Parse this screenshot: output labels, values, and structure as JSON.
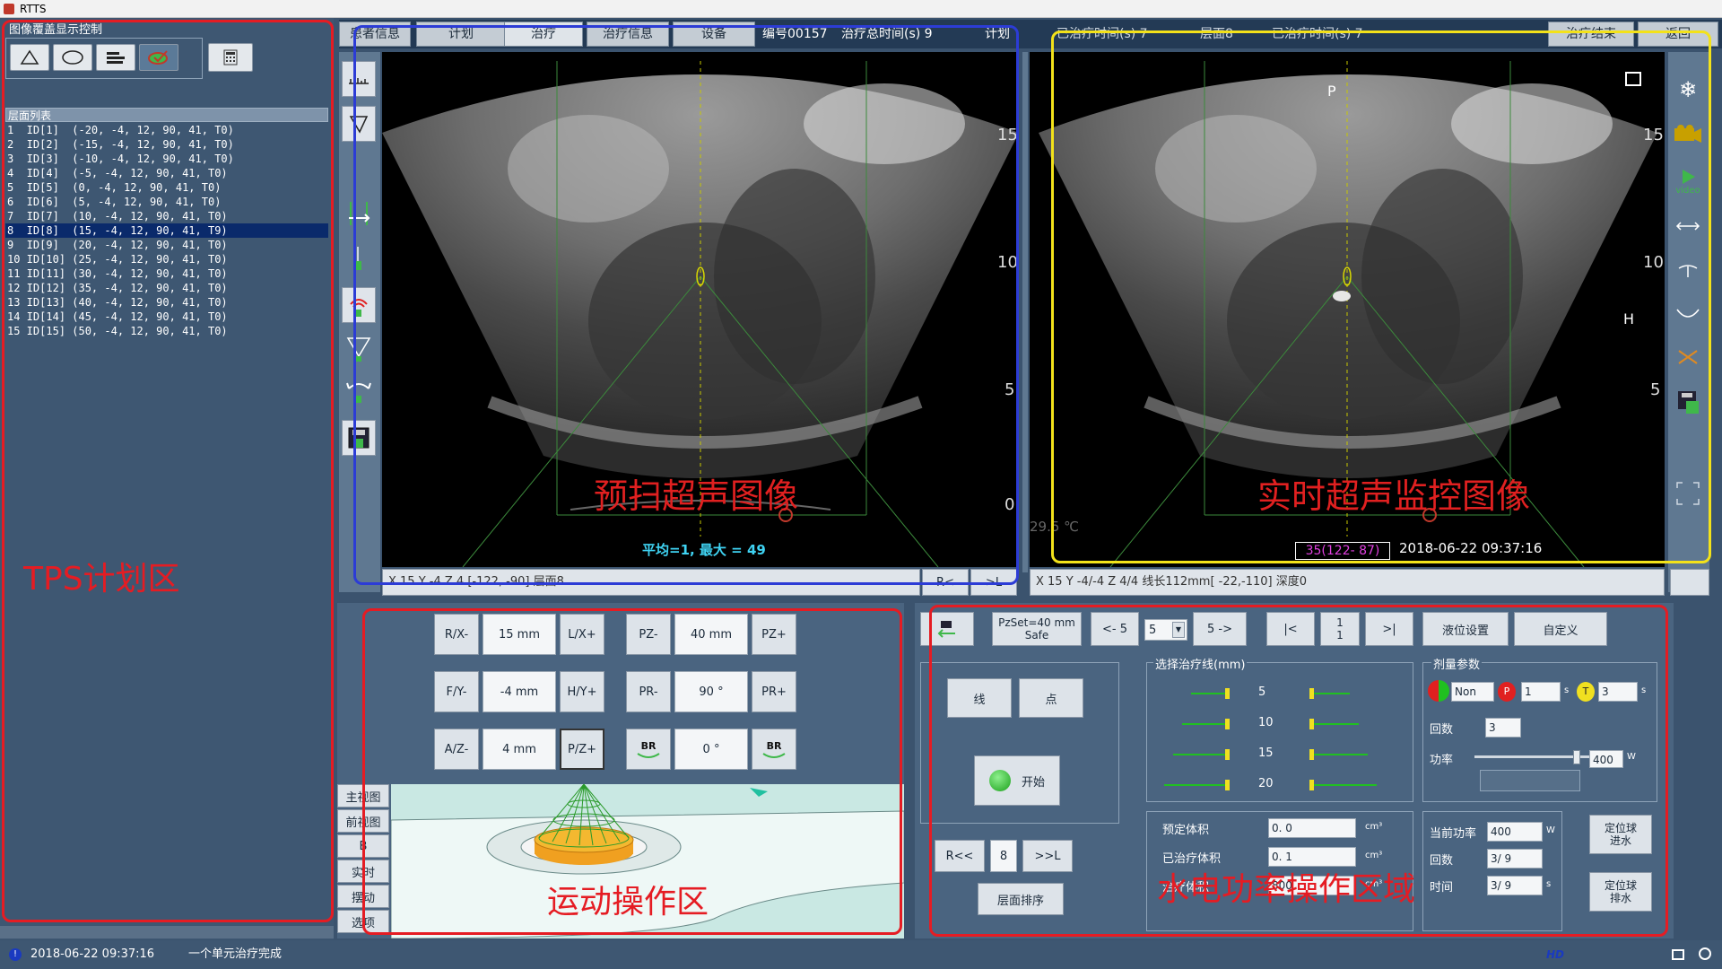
{
  "window": {
    "title": "RTTS"
  },
  "left_panel": {
    "overlay_group_title": "图像覆盖显示控制",
    "layer_list_header": "层面列表",
    "layers": [
      "1  ID[1]  (-20, -4, 12, 90, 41, T0)",
      "2  ID[2]  (-15, -4, 12, 90, 41, T0)",
      "3  ID[3]  (-10, -4, 12, 90, 41, T0)",
      "4  ID[4]  (-5, -4, 12, 90, 41, T0)",
      "5  ID[5]  (0, -4, 12, 90, 41, T0)",
      "6  ID[6]  (5, -4, 12, 90, 41, T0)",
      "7  ID[7]  (10, -4, 12, 90, 41, T0)",
      "8  ID[8]  (15, -4, 12, 90, 41, T9)",
      "9  ID[9]  (20, -4, 12, 90, 41, T0)",
      "10 ID[10] (25, -4, 12, 90, 41, T0)",
      "11 ID[11] (30, -4, 12, 90, 41, T0)",
      "12 ID[12] (35, -4, 12, 90, 41, T0)",
      "13 ID[13] (40, -4, 12, 90, 41, T0)",
      "14 ID[14] (45, -4, 12, 90, 41, T0)",
      "15 ID[15] (50, -4, 12, 90, 41, T0)"
    ],
    "selected_layer_index": 7,
    "region_label": "TPS计划区"
  },
  "tabs": {
    "patient_info": "患者信息",
    "plan": "计划",
    "treatment": "治疗",
    "treatment_info": "治疗信息",
    "device": "设备",
    "serial_text": "编号00157",
    "total_time_text": "治疗总时间(s) 9",
    "plan_text": "计划",
    "treated_time_text": "已治疗时间(s) 7",
    "layer_text": "层面8",
    "treated_time2_text": "已治疗时间(s) 7",
    "end_treatment": "治疗结束",
    "back": "返回"
  },
  "left_image": {
    "label": "预扫超声图像",
    "stats": "平均=1, 最大 = 49",
    "scale": [
      "15",
      "10",
      "5",
      "0"
    ],
    "status": "X 15   Y -4   Z 4      [-122, -90]  层面8",
    "nav_prev": "R<",
    "nav_next": ">L"
  },
  "right_image": {
    "label": "实时超声监控图像",
    "orientation_top": "P",
    "orientation_right": "H",
    "temperature": "29.5 ℃",
    "counter": "35(122- 87)",
    "timestamp": "2018-06-22 09:37:16",
    "scale": [
      "15",
      "10",
      "5",
      "0"
    ],
    "status": "X 15   Y -4/-4  Z    4/4  线长112mm[ -22,-110]  深度0",
    "video_label": "video"
  },
  "motion": {
    "region_label": "运动操作区",
    "rx_minus": "R/X-",
    "x_value": "15  mm",
    "lx_plus": "L/X+",
    "fy_minus": "F/Y-",
    "y_value": "-4  mm",
    "hy_plus": "H/Y+",
    "az_minus": "A/Z-",
    "z_value": "4  mm",
    "pz_plus_small": "P/Z+",
    "pz_minus": "PZ-",
    "pz_value": "40  mm",
    "pz_plus": "PZ+",
    "pr_minus": "PR-",
    "pr_value": "90  °",
    "pr_plus": "PR+",
    "br_value": "0  °",
    "br_label": "BR",
    "views": [
      "主视图",
      "前视图",
      "B",
      "实时",
      "摆动",
      "选项"
    ]
  },
  "water_power": {
    "region_label": "水电功率操作区域",
    "pzset": "PzSet=40 mm",
    "safe": "Safe",
    "prev5": "<- 5",
    "step_select": "5",
    "next5": "5 ->",
    "first": "|<",
    "page_top": "1",
    "page_bottom": "1",
    "last": ">|",
    "level_settings": "液位设置",
    "custom": "自定义",
    "line": "线",
    "point": "点",
    "start": "开始",
    "nav_r": "R<<",
    "nav_value": "8",
    "nav_l": ">>L",
    "layer_sort": "层面排序",
    "select_line_title": "选择治疗线(mm)",
    "lines": [
      "5",
      "10",
      "15",
      "20"
    ],
    "dose_title": "剂量参数",
    "dose_mode": "Non",
    "dose_p": "1",
    "dose_t": "3",
    "unit_s": "s",
    "times_label": "回数",
    "times_value": "3",
    "power_label": "功率",
    "power_value": "400",
    "power_unit": "W",
    "planned_volume_label": "预定体积",
    "planned_volume": "0. 0",
    "treated_volume_label": "已治疗体积",
    "treated_volume": "0. 1",
    "third_label": "治疗体积",
    "third_value": "800",
    "volume_unit": "cm³",
    "current_power_label": "当前功率",
    "current_power": "400",
    "current_power_unit": "W",
    "count_label": "回数",
    "count_value": "3/  9",
    "time_label": "时间",
    "time_value": "3/  9",
    "time_unit": "s",
    "ball_fill": "定位球\n进水",
    "ball_drain": "定位球\n排水"
  },
  "statusbar": {
    "timestamp": "2018-06-22  09:37:16",
    "message": "一个单元治疗完成",
    "right_tag": "HD"
  },
  "colors": {
    "annotation_red": "#e51c23",
    "annotation_blue": "#2c3cd6",
    "annotation_yellow": "#f3e21a",
    "panel_bg": "#3e5772"
  }
}
